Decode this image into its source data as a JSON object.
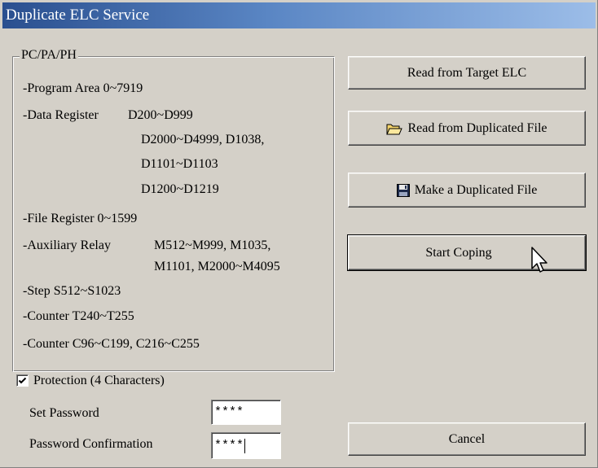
{
  "window": {
    "title": "Duplicate ELC Service"
  },
  "group": {
    "legend": "PC/PA/PH",
    "lines": [
      "-Program Area 0~7919",
      "-Data Register",
      "D200~D999",
      "D2000~D4999, D1038,",
      "D1101~D1103",
      "D1200~D1219",
      "-File Register 0~1599",
      "-Auxiliary Relay",
      "M512~M999, M1035,",
      "M1101, M2000~M4095",
      "-Step S512~S1023",
      "-Counter T240~T255",
      "-Counter C96~C199, C216~C255"
    ]
  },
  "buttons": {
    "read_target": "Read from Target ELC",
    "read_file": "Read from Duplicated File",
    "make_file": "Make a Duplicated File",
    "start": "Start Coping",
    "cancel": "Cancel"
  },
  "protection": {
    "label": "Protection (4 Characters)",
    "checked": true,
    "set_password_label": "Set Password",
    "set_password_value": "****",
    "confirm_label": "Password Confirmation",
    "confirm_value": "****"
  },
  "colors": {
    "dialog_bg": "#d4d0c8",
    "title_start": "#2a4f8f",
    "title_end": "#9cbde8"
  },
  "icons": {
    "read_file": "open-folder-icon",
    "make_file": "floppy-disk-icon",
    "cursor": "mouse-pointer-icon"
  }
}
